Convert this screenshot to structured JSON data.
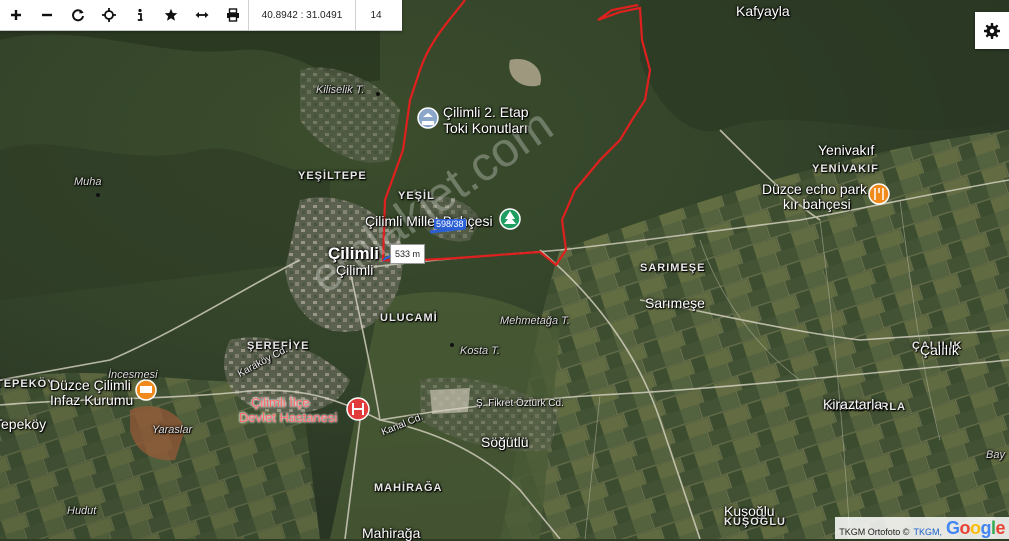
{
  "toolbar": {
    "coordinates": "40.8942 : 31.0491",
    "zoom_level": "14"
  },
  "settings_icon": "gear-icon",
  "measurements": {
    "distance_label": "533 m",
    "line_label": "598/38"
  },
  "places": {
    "kafyayla": "Kafyayla",
    "kiliselik": "Kiliselik T.",
    "cilimli_etap_1": "Çilimli 2. Etap",
    "cilimli_etap_2": "Toki Konutları",
    "yesiltepe": "YEŞİLTEPE",
    "yesil": "YEŞİL",
    "muha": "Muha",
    "cilimli_millet": "Çilimli Millet Bahçesi",
    "cilimli_caps": "Çilimli",
    "cilimli": "Çilimli",
    "yenivakif": "Yenivakıf",
    "yenivakif_caps": "YENİVAKIF",
    "duzce_echo_1": "Düzce echo park",
    "duzce_echo_2": "kır bahçesi",
    "sarimese_caps": "SARIMEŞE",
    "sarimese": "Sarımeşe",
    "ulucami": "ULUCAMİ",
    "mehmetaga": "Mehmetağa T.",
    "kosta": "Kosta T.",
    "sereftiye": "ŞEREFİYE",
    "karakoy_cd": "Karaköy Cd.",
    "incesmesi": "İncesmesi",
    "tepekoy_caps": "TEPEKÖY",
    "tepekoy": "Tepeköy",
    "infaz_1": "Düzce Çilimli",
    "infaz_2": "Infaz Kurumu",
    "yaraslar": "Yaraslar",
    "hastane_1": "Çilimli İlçe",
    "hastane_2": "Devlet Hastanesi",
    "kanal_cd": "Kanal Cd.",
    "fikret_cd": "Ş. Fikret Öztürk Cd.",
    "sogutlu": "Söğütlü",
    "mahiraga_caps": "MAHİRAĞA",
    "mahiraga": "Mahirağa",
    "hudut": "Hudut",
    "kusoglu": "Kuşoğlu",
    "kusoglu_caps": "KUŞOĞLU",
    "calilik": "Çalılık",
    "calilik_caps": "ÇALILIK",
    "kiraztarla": "Kiraztarla",
    "kiraztarla_caps": "KİRAZTARLA",
    "bay": "Bay"
  },
  "watermark": "emlakjet.com",
  "attribution": {
    "text": "TKGM Ortofoto ©",
    "link": "TKGM,",
    "logo": "Google"
  },
  "colors": {
    "parcel_border": "#e0201e",
    "measure_line": "#2a5fd6",
    "poi_red": "#e23b3b",
    "poi_orange": "#f08a1c",
    "poi_green": "#1f9e62",
    "poi_blue": "#8aa6c8"
  }
}
